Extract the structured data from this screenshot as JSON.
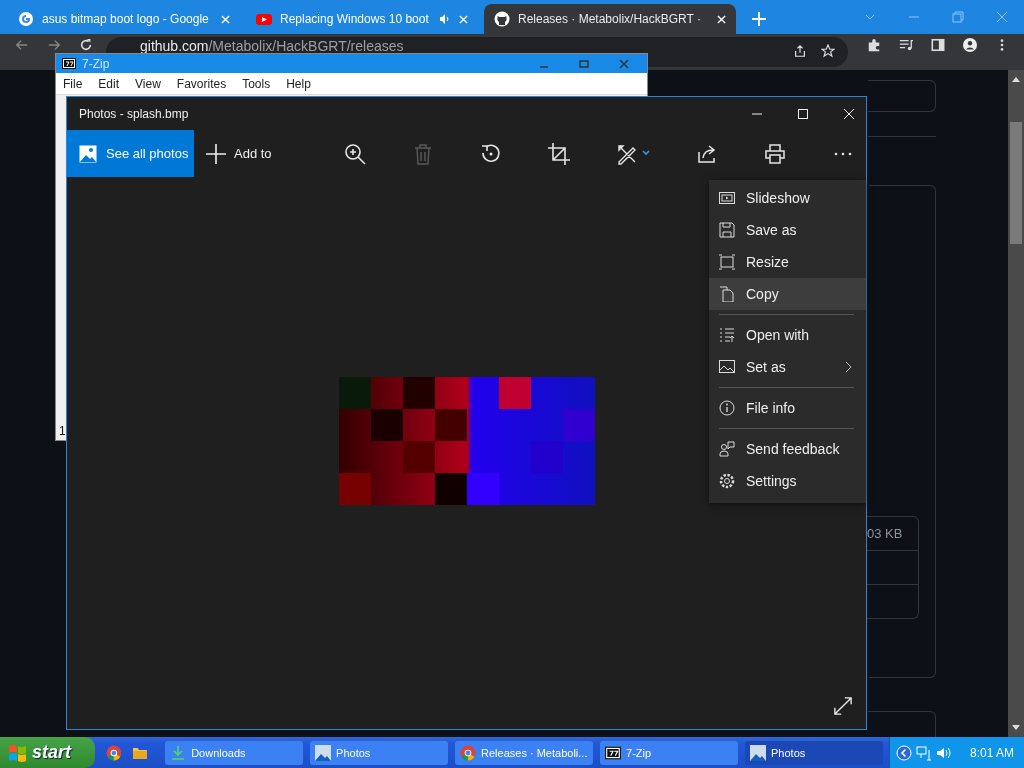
{
  "browser": {
    "tabs": [
      {
        "title": "asus bitmap boot logo - Google",
        "kind": "google",
        "selected": false,
        "audio": false
      },
      {
        "title": "Replacing Windows 10 boot",
        "kind": "youtube",
        "selected": false,
        "audio": true
      },
      {
        "title": "Releases · Metabolix/HackBGRT ·",
        "kind": "github",
        "selected": true,
        "audio": false
      }
    ],
    "url": {
      "host": "github.com",
      "path": "/Metabolix/HackBGRT/releases"
    }
  },
  "page": {
    "asset_size": "03 KB"
  },
  "zip_window": {
    "title": "7-Zip",
    "menu": [
      "File",
      "Edit",
      "View",
      "Favorites",
      "Tools",
      "Help"
    ],
    "status": "1"
  },
  "photos": {
    "title": "Photos - splash.bmp",
    "see_all": "See all photos",
    "add_to": "Add to",
    "tools": [
      {
        "kind": "zoom",
        "disabled": false
      },
      {
        "kind": "delete",
        "disabled": true
      },
      {
        "kind": "rotate",
        "disabled": false
      },
      {
        "kind": "crop",
        "disabled": false
      },
      {
        "kind": "edit",
        "disabled": false
      },
      {
        "kind": "share",
        "disabled": false
      },
      {
        "kind": "print",
        "disabled": false
      },
      {
        "kind": "more",
        "disabled": false
      }
    ],
    "menu": [
      {
        "label": "Slideshow",
        "kind": "slideshow",
        "highlighted": false,
        "separator_before": false,
        "submenu": false
      },
      {
        "label": "Save as",
        "kind": "save",
        "highlighted": false,
        "separator_before": false,
        "submenu": false
      },
      {
        "label": "Resize",
        "kind": "resize",
        "highlighted": false,
        "separator_before": false,
        "submenu": false
      },
      {
        "label": "Copy",
        "kind": "copy",
        "highlighted": true,
        "separator_before": false,
        "submenu": false
      },
      {
        "label": "Open with",
        "kind": "open",
        "highlighted": false,
        "separator_before": true,
        "submenu": false
      },
      {
        "label": "Set as",
        "kind": "setas",
        "highlighted": false,
        "separator_before": false,
        "submenu": true
      },
      {
        "label": "File info",
        "kind": "info",
        "highlighted": false,
        "separator_before": true,
        "submenu": false
      },
      {
        "label": "Send feedback",
        "kind": "feedback",
        "highlighted": false,
        "separator_before": true,
        "submenu": false
      },
      {
        "label": "Settings",
        "kind": "settings",
        "highlighted": false,
        "separator_before": false,
        "submenu": false
      }
    ]
  },
  "taskbar": {
    "start": "start",
    "tasks": [
      {
        "label": "Downloads",
        "kind": "downloads",
        "selected": false
      },
      {
        "label": "Photos",
        "kind": "photos",
        "selected": false
      },
      {
        "label": "Releases · Metaboli...",
        "kind": "chrome",
        "selected": false
      },
      {
        "label": "7-Zip",
        "kind": "zip",
        "selected": false
      },
      {
        "label": "Photos",
        "kind": "photos",
        "selected": true
      }
    ],
    "clock": "8:01 AM"
  }
}
